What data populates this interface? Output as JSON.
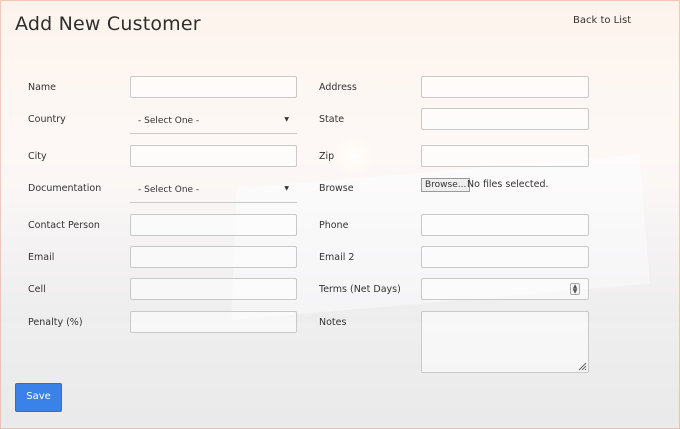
{
  "header": {
    "title": "Add New Customer",
    "back_link": "Back to List"
  },
  "form": {
    "left": [
      {
        "label": "Name",
        "type": "text",
        "value": ""
      },
      {
        "label": "Country",
        "type": "select",
        "value": "- Select One -"
      },
      {
        "label": "City",
        "type": "text",
        "value": ""
      },
      {
        "label": "Documentation",
        "type": "select",
        "value": "- Select One -"
      },
      {
        "label": "Contact Person",
        "type": "text",
        "value": ""
      },
      {
        "label": "Email",
        "type": "text",
        "value": ""
      },
      {
        "label": "Cell",
        "type": "text",
        "value": ""
      },
      {
        "label": "Penalty (%)",
        "type": "text",
        "value": ""
      }
    ],
    "right": [
      {
        "label": "Address",
        "type": "text",
        "value": ""
      },
      {
        "label": "State",
        "type": "text",
        "value": ""
      },
      {
        "label": "Zip",
        "type": "text",
        "value": ""
      },
      {
        "label": "Browse",
        "type": "file",
        "button": "Browse...",
        "status": "No files selected."
      },
      {
        "label": "Phone",
        "type": "text",
        "value": ""
      },
      {
        "label": "Email 2",
        "type": "text",
        "value": ""
      },
      {
        "label": "Terms (Net Days)",
        "type": "number",
        "value": ""
      },
      {
        "label": "Notes",
        "type": "textarea",
        "value": ""
      }
    ]
  },
  "actions": {
    "save_label": "Save"
  },
  "icons": {
    "select_caret": "caret-down-icon",
    "spinner": "spinner-icon",
    "resize": "resize-handle-icon"
  }
}
